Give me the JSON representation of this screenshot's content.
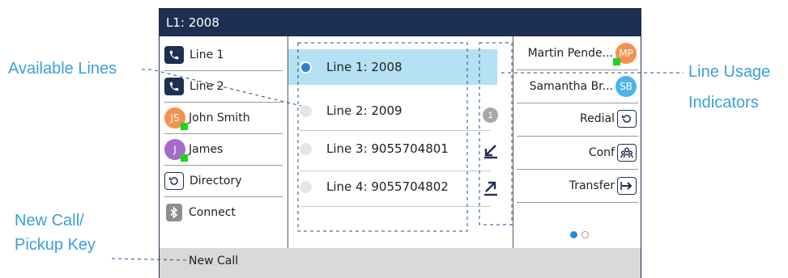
{
  "callouts": {
    "available_lines": "Available Lines",
    "line_usage_1": "Line Usage",
    "line_usage_2": "Indicators",
    "new_call_1": "New Call/",
    "new_call_2": "Pickup Key"
  },
  "title": "L1: 2008",
  "left_keys": [
    {
      "label": "Line 1",
      "icon": "phone-icon"
    },
    {
      "label": "Line 2",
      "icon": "phone-icon"
    },
    {
      "label": "John Smith",
      "initials": "JS",
      "icon": "avatar",
      "color": "#f5914e",
      "presence": "#1fd31f"
    },
    {
      "label": "James",
      "initials": "J",
      "icon": "avatar",
      "color": "#a56bc8",
      "presence": "#1fd31f"
    },
    {
      "label": "Directory",
      "icon": "directory-icon"
    },
    {
      "label": "Connect",
      "icon": "bluetooth-icon"
    }
  ],
  "lines": [
    {
      "label": "Line 1: 2008",
      "selected": true
    },
    {
      "label": "Line 2: 2009",
      "selected": false
    },
    {
      "label": "Line 3: 9055704801",
      "selected": false
    },
    {
      "label": "Line 4: 9055704802",
      "selected": false
    }
  ],
  "usage_indicators": {
    "missed_count": "1",
    "incoming_icon": "incoming-call-arrow-icon",
    "outgoing_icon": "outgoing-call-arrow-icon"
  },
  "right_keys": [
    {
      "label": "Martin Pende...",
      "initials": "MP",
      "icon": "avatar",
      "color": "#f5914e",
      "presence": "#1fd31f"
    },
    {
      "label": "Samantha Br...",
      "initials": "SB",
      "icon": "avatar",
      "color": "#4bb4ea"
    },
    {
      "label": "Redial",
      "icon": "redial-icon"
    },
    {
      "label": "Conf",
      "icon": "conference-icon"
    },
    {
      "label": "Transfer",
      "icon": "transfer-icon"
    }
  ],
  "pager": {
    "pages": 2,
    "current": 1,
    "active_color": "#2a8ad8"
  },
  "softkeys": {
    "new_call": "New Call"
  },
  "colors": {
    "accent": "#1d2f52",
    "selection": "#b5e1f3",
    "callout": "#3aa0d8"
  }
}
